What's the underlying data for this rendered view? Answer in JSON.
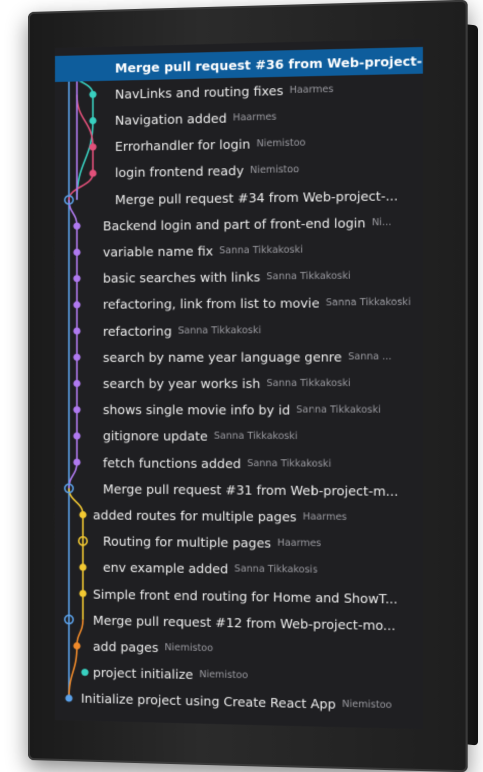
{
  "colors": {
    "selected_bg": "#0e5d9c",
    "lane_blue": "#5aa0e8",
    "lane_purple": "#b07af0",
    "lane_teal": "#38d0c0",
    "lane_pink": "#e2507a",
    "lane_yellow": "#f2c832",
    "lane_orange": "#f08a2a"
  },
  "commits": [
    {
      "message": "Merge pull request #36 from Web-project-...",
      "author": "",
      "lane_color": "#5aa0e8",
      "selected": true,
      "merge": true
    },
    {
      "message": "NavLinks and routing fixes",
      "author": "Haarmes",
      "lane_color": "#38d0c0",
      "selected": false,
      "merge": false
    },
    {
      "message": "Navigation added",
      "author": "Haarmes",
      "lane_color": "#38d0c0",
      "selected": false,
      "merge": false
    },
    {
      "message": "Errorhandler for login",
      "author": "Niemistoo",
      "lane_color": "#e2507a",
      "selected": false,
      "merge": false
    },
    {
      "message": "login frontend ready",
      "author": "Niemistoo",
      "lane_color": "#e2507a",
      "selected": false,
      "merge": false
    },
    {
      "message": "Merge pull request #34 from Web-project-...",
      "author": "",
      "lane_color": "#5aa0e8",
      "selected": false,
      "merge": true
    },
    {
      "message": "Backend login and part of front-end login",
      "author": "Ni...",
      "lane_color": "#b07af0",
      "selected": false,
      "merge": false
    },
    {
      "message": "variable name fix",
      "author": "Sanna Tikkakoski",
      "lane_color": "#b07af0",
      "selected": false,
      "merge": false
    },
    {
      "message": "basic searches with links",
      "author": "Sanna Tikkakoski",
      "lane_color": "#b07af0",
      "selected": false,
      "merge": false
    },
    {
      "message": "refactoring, link from list to movie",
      "author": "Sanna Tikkakoski",
      "lane_color": "#b07af0",
      "selected": false,
      "merge": false
    },
    {
      "message": "refactoring",
      "author": "Sanna Tikkakoski",
      "lane_color": "#b07af0",
      "selected": false,
      "merge": false
    },
    {
      "message": "search by name year language genre",
      "author": "Sanna ...",
      "lane_color": "#b07af0",
      "selected": false,
      "merge": false
    },
    {
      "message": "search by year works ish",
      "author": "Sanna Tikkakoski",
      "lane_color": "#b07af0",
      "selected": false,
      "merge": false
    },
    {
      "message": "shows single movie info by id",
      "author": "Sanna Tikkakoski",
      "lane_color": "#b07af0",
      "selected": false,
      "merge": false
    },
    {
      "message": "gitignore update",
      "author": "Sanna Tikkakoski",
      "lane_color": "#b07af0",
      "selected": false,
      "merge": false
    },
    {
      "message": "fetch functions added",
      "author": "Sanna Tikkakoski",
      "lane_color": "#b07af0",
      "selected": false,
      "merge": false
    },
    {
      "message": "Merge pull request #31 from Web-project-m...",
      "author": "",
      "lane_color": "#5aa0e8",
      "selected": false,
      "merge": true
    },
    {
      "message": "added routes for multiple pages",
      "author": "Haarmes",
      "lane_color": "#f2c832",
      "selected": false,
      "merge": false
    },
    {
      "message": "Routing for multiple pages",
      "author": "Haarmes",
      "lane_color": "#f2c832",
      "selected": false,
      "merge": true
    },
    {
      "message": "env example added",
      "author": "Sanna Tikkakosis",
      "lane_color": "#f2c832",
      "selected": false,
      "merge": false
    },
    {
      "message": "Simple front end routing for Home and ShowT...",
      "author": "",
      "lane_color": "#f2c832",
      "selected": false,
      "merge": false
    },
    {
      "message": "Merge pull request #12 from Web-project-mo...",
      "author": "",
      "lane_color": "#5aa0e8",
      "selected": false,
      "merge": true
    },
    {
      "message": "add pages",
      "author": "Niemistoo",
      "lane_color": "#f08a2a",
      "selected": false,
      "merge": false
    },
    {
      "message": "project initialize",
      "author": "Niemistoo",
      "lane_color": "#38d0c0",
      "selected": false,
      "merge": false
    },
    {
      "message": "Initialize project using Create React App",
      "author": "Niemistoo",
      "lane_color": "#5aa0e8",
      "selected": false,
      "merge": false
    }
  ]
}
